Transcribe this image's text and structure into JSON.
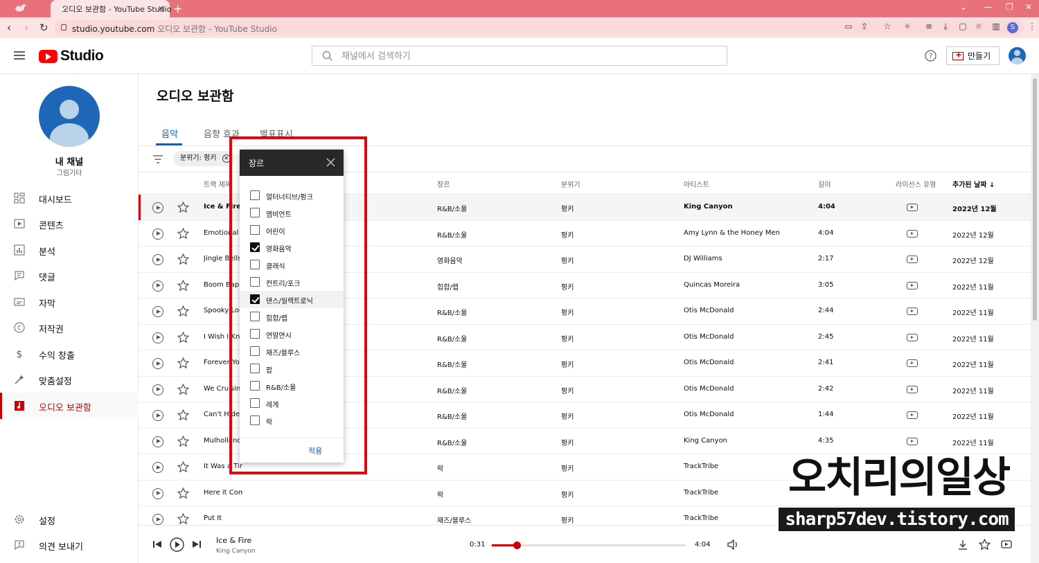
{
  "browser": {
    "tab_title": "오디오 보관함 - YouTube Studio",
    "url_host": "studio.youtube.com",
    "url_path": "오디오 보관함 - YouTube Studio",
    "profile_initial": "S"
  },
  "header": {
    "brand": "Studio",
    "search_placeholder": "채널에서 검색하기",
    "create_label": "만들기"
  },
  "sidebar": {
    "channel_name": "내 채널",
    "channel_sub": "그림기타",
    "items": [
      {
        "label": "대시보드",
        "icon": "dashboard-icon"
      },
      {
        "label": "콘텐츠",
        "icon": "content-icon"
      },
      {
        "label": "분석",
        "icon": "analytics-icon"
      },
      {
        "label": "댓글",
        "icon": "comments-icon"
      },
      {
        "label": "자막",
        "icon": "subtitles-icon"
      },
      {
        "label": "저작권",
        "icon": "copyright-icon"
      },
      {
        "label": "수익 창출",
        "icon": "monetization-icon"
      },
      {
        "label": "맞춤설정",
        "icon": "customization-icon"
      },
      {
        "label": "오디오 보관함",
        "icon": "audio-library-icon"
      }
    ],
    "bottom": [
      {
        "label": "설정",
        "icon": "settings-icon"
      },
      {
        "label": "의견 보내기",
        "icon": "feedback-icon"
      }
    ]
  },
  "main": {
    "title": "오디오 보관함",
    "tabs": [
      "음악",
      "음향 효과",
      "별표표시"
    ],
    "filter_chip": "분위기: 펑키",
    "columns": {
      "title": "트랙 제목",
      "genre": "장르",
      "mood": "분위기",
      "artist": "아티스트",
      "length": "길이",
      "license": "라이선스 유형",
      "date": "추가된 날짜 ↓"
    },
    "rows": [
      {
        "title": "Ice & Fire",
        "genre": "R&B/소울",
        "mood": "펑키",
        "artist": "King Canyon",
        "length": "4:04",
        "date": "2022년 12월"
      },
      {
        "title": "Emotional Mess",
        "genre": "R&B/소울",
        "mood": "펑키",
        "artist": "Amy Lynn & the Honey Men",
        "length": "4:04",
        "date": "2022년 12월"
      },
      {
        "title": "Jingle Bells",
        "genre": "영화음악",
        "mood": "펑키",
        "artist": "DJ Williams",
        "length": "2:17",
        "date": "2022년 12월"
      },
      {
        "title": "Boom Bap Flick",
        "genre": "힙합/랩",
        "mood": "펑키",
        "artist": "Quincas Moreira",
        "length": "3:05",
        "date": "2022년 11월"
      },
      {
        "title": "Spooky Loop",
        "genre": "R&B/소울",
        "mood": "펑키",
        "artist": "Otis McDonald",
        "length": "2:44",
        "date": "2022년 11월"
      },
      {
        "title": "I Wish I Knew",
        "genre": "R&B/소울",
        "mood": "펑키",
        "artist": "Otis McDonald",
        "length": "2:45",
        "date": "2022년 11월"
      },
      {
        "title": "Forever You",
        "genre": "R&B/소울",
        "mood": "펑키",
        "artist": "Otis McDonald",
        "length": "2:41",
        "date": "2022년 11월"
      },
      {
        "title": "We Cruisin'",
        "genre": "R&B/소울",
        "mood": "펑키",
        "artist": "Otis McDonald",
        "length": "2:42",
        "date": "2022년 11월"
      },
      {
        "title": "Can't Hide",
        "genre": "R&B/소울",
        "mood": "펑키",
        "artist": "Otis McDonald",
        "length": "1:44",
        "date": "2022년 11월"
      },
      {
        "title": "Mulholland",
        "genre": "R&B/소울",
        "mood": "펑키",
        "artist": "King Canyon",
        "length": "4:35",
        "date": "2022년 11월"
      },
      {
        "title": "It Was a Time",
        "genre": "락",
        "mood": "펑키",
        "artist": "TrackTribe",
        "length": "",
        "date": ""
      },
      {
        "title": "Here it Comes",
        "genre": "락",
        "mood": "펑키",
        "artist": "TrackTribe",
        "length": "",
        "date": ""
      },
      {
        "title": "Put It",
        "genre": "재즈/블루스",
        "mood": "펑키",
        "artist": "TrackTribe",
        "length": "",
        "date": ""
      }
    ]
  },
  "genre_dropdown": {
    "title": "장르",
    "options": [
      {
        "label": "얼터너티브/펑크",
        "checked": false
      },
      {
        "label": "앰비언트",
        "checked": false
      },
      {
        "label": "어린이",
        "checked": false
      },
      {
        "label": "영화음악",
        "checked": true
      },
      {
        "label": "클래식",
        "checked": false
      },
      {
        "label": "컨트리/포크",
        "checked": false
      },
      {
        "label": "댄스/일렉트로닉",
        "checked": true
      },
      {
        "label": "힙합/랩",
        "checked": false
      },
      {
        "label": "연말연시",
        "checked": false
      },
      {
        "label": "재즈/블루스",
        "checked": false
      },
      {
        "label": "팝",
        "checked": false
      },
      {
        "label": "R&B/소울",
        "checked": false
      },
      {
        "label": "레게",
        "checked": false
      },
      {
        "label": "락",
        "checked": false
      }
    ],
    "apply_label": "적용"
  },
  "player": {
    "title": "Ice & Fire",
    "artist": "King Canyon",
    "current": "0:31",
    "duration": "4:04",
    "progress": 0.127
  },
  "watermark": {
    "line1": "오치리의일상",
    "line2": "sharp57dev.tistory.com"
  },
  "colors": {
    "accent": "#cc0000",
    "link": "#065fd4",
    "highlight_box": "#e8000b"
  }
}
